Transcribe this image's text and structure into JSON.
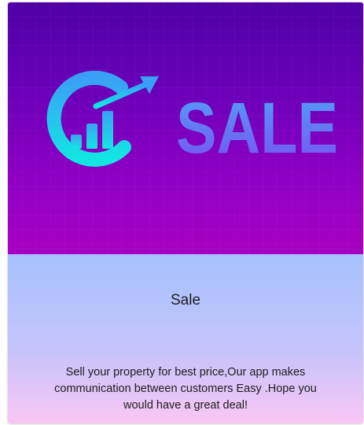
{
  "card": {
    "image": {
      "logo_text": "SALE",
      "icon": "growth-chart-icon"
    },
    "title": "Sale",
    "description": "Sell your property for best price,Our app makes communication between customers Easy .Hope you would have a great deal!"
  },
  "colors": {
    "banner_top": "#4f00a6",
    "banner_bottom": "#a800c2",
    "logo_cyan": "#18e0e8",
    "logo_blue": "#6a5af7",
    "body_top": "#a6c1ff",
    "body_bottom": "#f9c6f5"
  }
}
